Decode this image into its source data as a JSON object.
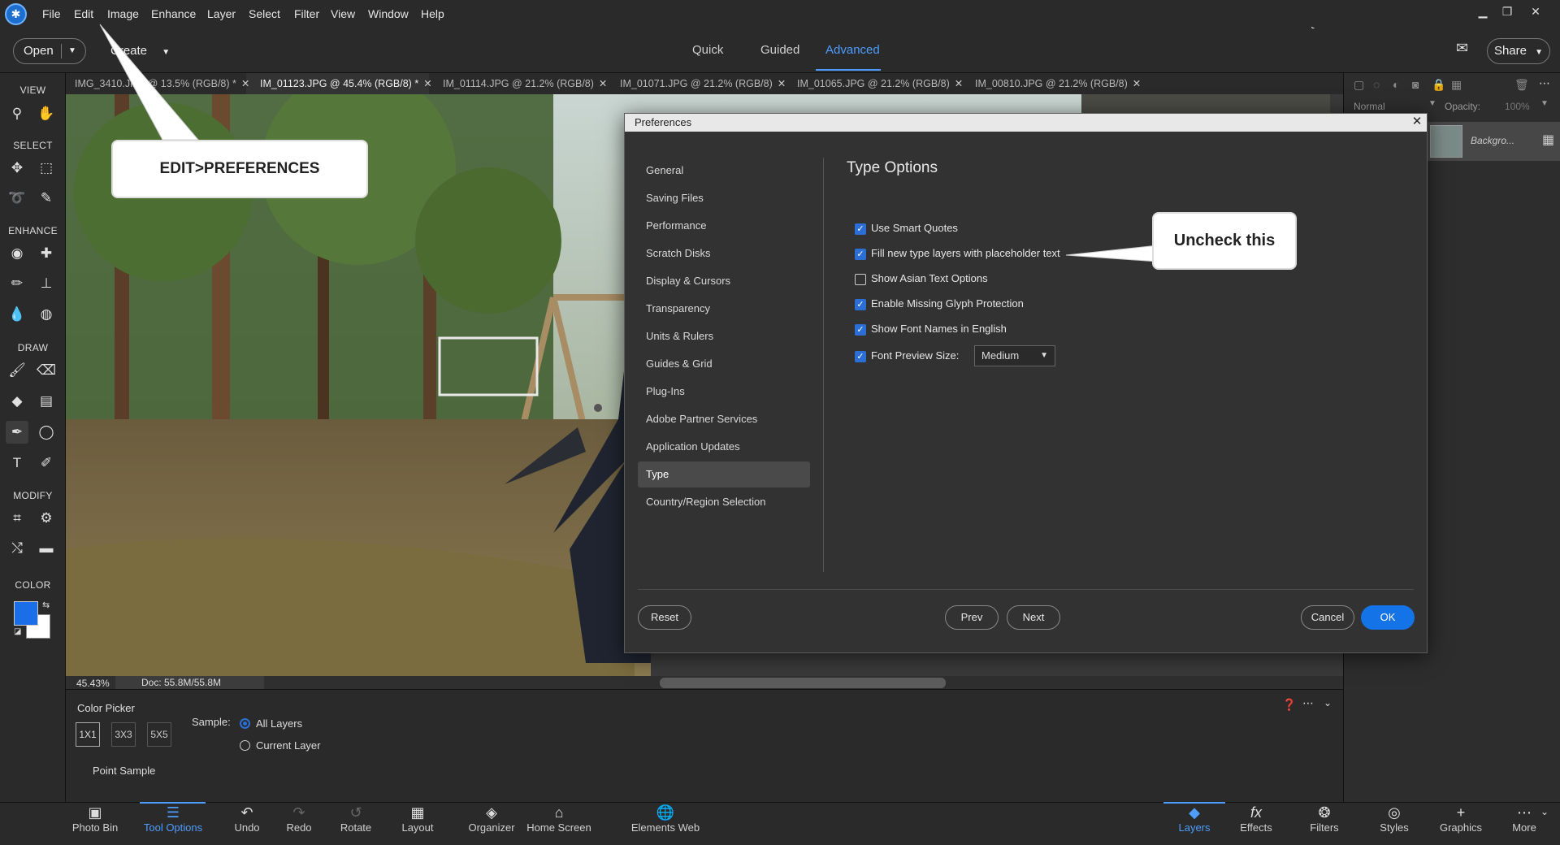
{
  "menubar": {
    "items": [
      "File",
      "Edit",
      "Image",
      "Enhance",
      "Layer",
      "Select",
      "Filter",
      "View",
      "Window",
      "Help"
    ]
  },
  "modebar": {
    "open_label": "Open",
    "create_label": "Create",
    "modes": [
      "Quick",
      "Guided",
      "Advanced"
    ],
    "share_label": "Share"
  },
  "tabs": [
    {
      "label": "IMG_3410.JPG @ 13.5% (RGB/8) *"
    },
    {
      "label": "IM_01123.JPG @ 45.4% (RGB/8) *"
    },
    {
      "label": "IM_01114.JPG @ 21.2% (RGB/8)"
    },
    {
      "label": "IM_01071.JPG @ 21.2% (RGB/8)"
    },
    {
      "label": "IM_01065.JPG @ 21.2% (RGB/8)"
    },
    {
      "label": "IM_00810.JPG @ 21.2% (RGB/8)"
    }
  ],
  "toolbar": {
    "sections": [
      "VIEW",
      "SELECT",
      "ENHANCE",
      "DRAW",
      "MODIFY",
      "COLOR"
    ]
  },
  "status": {
    "zoom": "45.43%",
    "doc": "Doc: 55.8M/55.8M"
  },
  "layers_panel": {
    "blend_mode": "Normal",
    "opacity_label": "Opacity:",
    "opacity_value": "100%",
    "layer_name": "Backgro..."
  },
  "tool_options": {
    "title": "Color Picker",
    "sizes": [
      "1X1",
      "3X3",
      "5X5"
    ],
    "sample_label": "Sample:",
    "sample_options": [
      "All Layers",
      "Current Layer"
    ],
    "point_sample": "Point Sample"
  },
  "bottombar": {
    "left": [
      "Photo Bin",
      "Tool Options",
      "Undo",
      "Redo",
      "Rotate",
      "Layout",
      "Organizer",
      "Home Screen",
      "Elements Web"
    ],
    "right": [
      "Layers",
      "Effects",
      "Filters",
      "Styles",
      "Graphics",
      "More"
    ]
  },
  "dialog": {
    "title": "Preferences",
    "nav": [
      "General",
      "Saving Files",
      "Performance",
      "Scratch Disks",
      "Display & Cursors",
      "Transparency",
      "Units & Rulers",
      "Guides & Grid",
      "Plug-Ins",
      "Adobe Partner Services",
      "Application Updates",
      "Type",
      "Country/Region Selection"
    ],
    "heading": "Type Options",
    "options": [
      {
        "label": "Use Smart Quotes",
        "checked": true
      },
      {
        "label": "Fill new type layers with placeholder text",
        "checked": true
      },
      {
        "label": "Show Asian Text Options",
        "checked": false
      },
      {
        "label": "Enable Missing Glyph Protection",
        "checked": true
      },
      {
        "label": "Show Font Names in English",
        "checked": true
      },
      {
        "label": "Font Preview Size:",
        "checked": true
      }
    ],
    "font_preview_value": "Medium",
    "buttons": {
      "reset": "Reset",
      "prev": "Prev",
      "next": "Next",
      "cancel": "Cancel",
      "ok": "OK"
    }
  },
  "callouts": {
    "edit_prefs": "EDIT>PREFERENCES",
    "uncheck": "Uncheck this"
  },
  "colors": {
    "accent": "#1473e6",
    "foreground_color": "#1a6fe8",
    "background_color": "#ffffff"
  }
}
